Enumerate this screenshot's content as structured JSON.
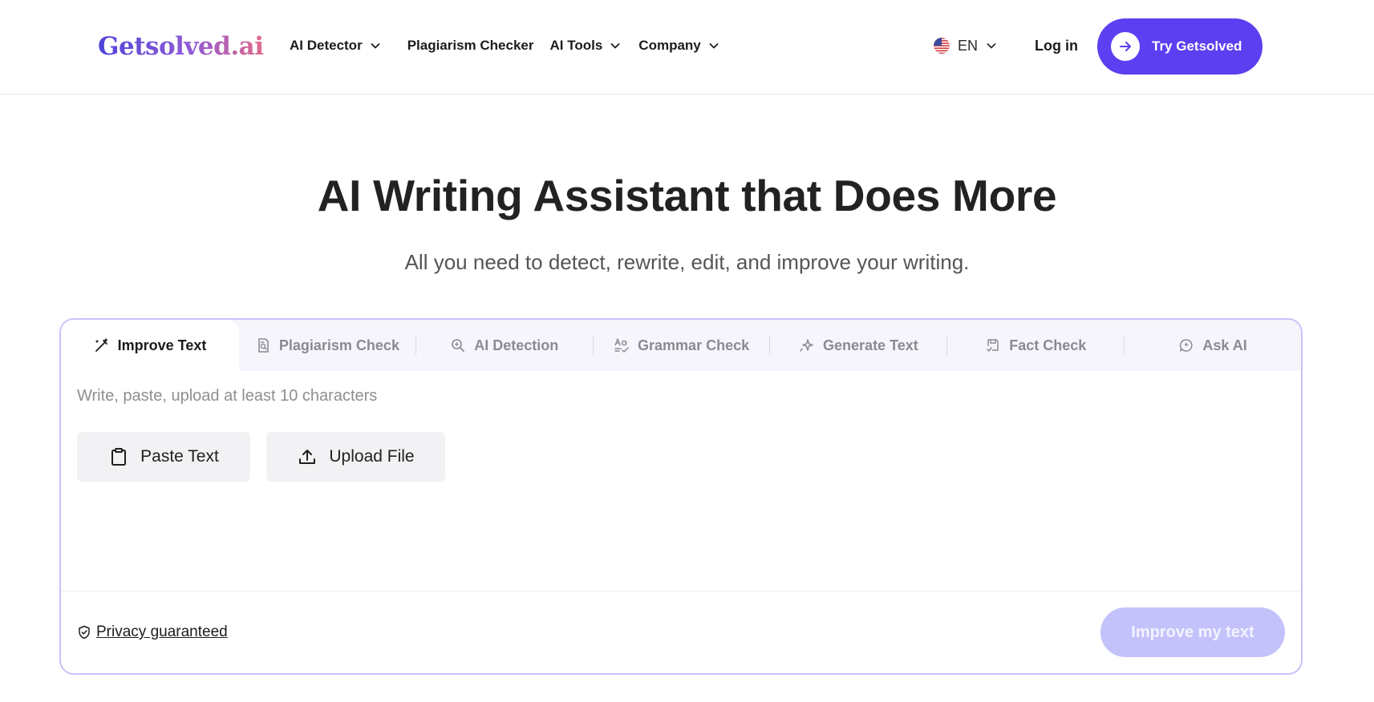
{
  "header": {
    "logo": "Getsolved.ai",
    "nav": [
      {
        "label": "AI Detector",
        "has_dropdown": true
      },
      {
        "label": "Plagiarism Checker",
        "has_dropdown": false
      },
      {
        "label": "AI Tools",
        "has_dropdown": true
      },
      {
        "label": "Company",
        "has_dropdown": true
      }
    ],
    "language": "EN",
    "login_label": "Log in",
    "cta_label": "Try Getsolved"
  },
  "hero": {
    "title": "AI Writing Assistant that Does More",
    "subtitle": "All you need to detect, rewrite, edit, and improve your writing."
  },
  "tool": {
    "tabs": [
      {
        "label": "Improve Text",
        "icon": "magic-wand-icon",
        "active": true
      },
      {
        "label": "Plagiarism Check",
        "icon": "document-search-icon",
        "active": false
      },
      {
        "label": "AI Detection",
        "icon": "magnifier-icon",
        "active": false
      },
      {
        "label": "Grammar Check",
        "icon": "grammar-icon",
        "active": false
      },
      {
        "label": "Generate Text",
        "icon": "sparkle-icon",
        "active": false
      },
      {
        "label": "Fact Check",
        "icon": "fact-check-icon",
        "active": false
      },
      {
        "label": "Ask AI",
        "icon": "chat-bubble-icon",
        "active": false
      }
    ],
    "placeholder": "Write, paste, upload at least 10 characters",
    "paste_label": "Paste Text",
    "upload_label": "Upload File",
    "privacy_label": "Privacy guaranteed",
    "submit_label": "Improve my text"
  },
  "colors": {
    "brand": "#5b3ff0",
    "card_border": "#c5c3fb",
    "submit_disabled": "#c4c2fb"
  }
}
